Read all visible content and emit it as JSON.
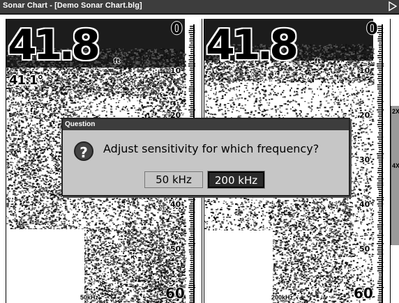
{
  "window": {
    "title": "Sonar Chart - [Demo Sonar Chart.blg]"
  },
  "left_pane": {
    "depth": "41.8",
    "depth_unit": "ft",
    "temperature": "41.1°",
    "frequency": "50kHz",
    "scale_labels": [
      "0",
      "10",
      "20",
      "30",
      "40",
      "50",
      "60"
    ]
  },
  "right_pane": {
    "depth": "41.8",
    "depth_unit": "ft",
    "frequency": "200kHz",
    "scale_labels": [
      "0",
      "10",
      "20",
      "30",
      "40",
      "50",
      "60"
    ]
  },
  "zoom_bar": {
    "items": [
      "2X",
      "4X"
    ]
  },
  "dialog": {
    "title": "Question",
    "icon": "question-icon",
    "message": "Adjust sensitivity for which frequency?",
    "buttons": [
      {
        "label": "50 kHz",
        "selected": false
      },
      {
        "label": "200 kHz",
        "selected": true
      }
    ]
  },
  "colors": {
    "titlebar": "#3d3d3d",
    "dialog_bg": "#c6c6c6",
    "selected_button": "#2a2a2a"
  }
}
